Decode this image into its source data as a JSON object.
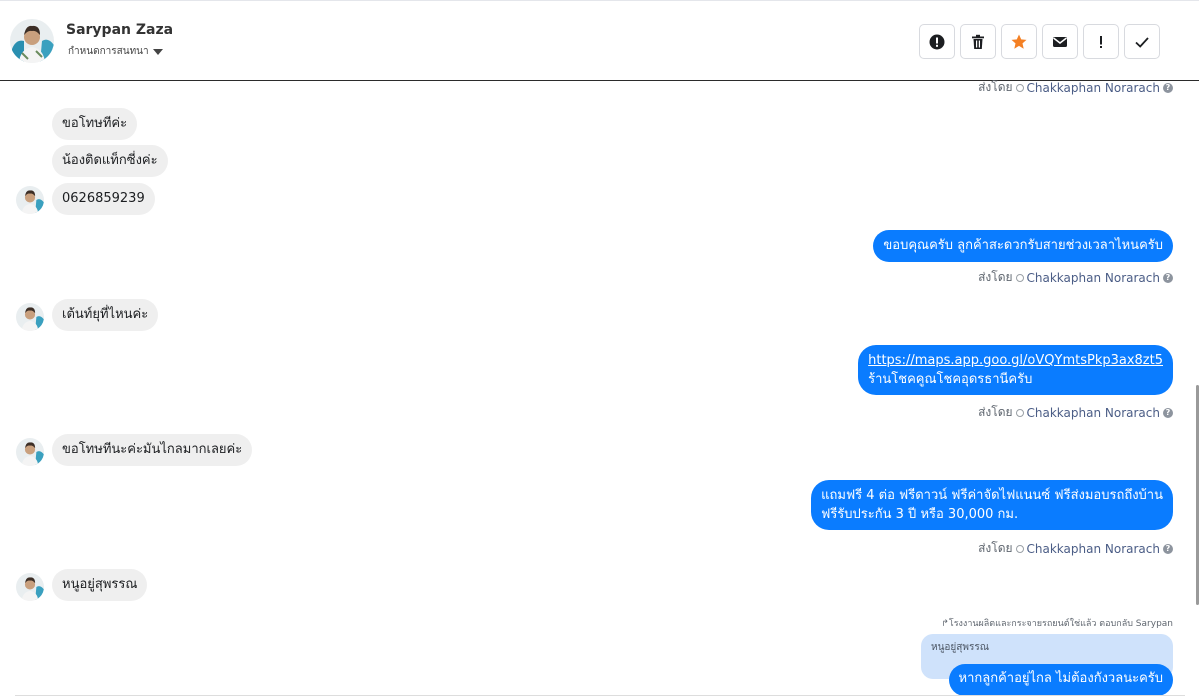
{
  "header": {
    "contact_name": "Sarypan Zaza",
    "subtitle": "กำหนดการสนทนา"
  },
  "toolbar": {
    "buttons": [
      {
        "icon": "alert-circle-icon"
      },
      {
        "icon": "trash-icon"
      },
      {
        "icon": "star-icon",
        "color": "#f48024"
      },
      {
        "icon": "mail-icon"
      },
      {
        "icon": "exclamation-icon"
      },
      {
        "icon": "check-icon"
      }
    ]
  },
  "meta": {
    "sent_by_label": "ส่งโดย",
    "agent_name": "Chakkaphan Norarach",
    "help_glyph": "?"
  },
  "messages": {
    "in_1": "ขอโทษทีค่ะ",
    "in_2": "น้องติดแท็กซี่งค่ะ",
    "in_3": "0626859239",
    "out_1": "ขอบคุณครับ ลูกค้าสะดวกรับสายช่วงเวลาไหนครับ",
    "in_4": "เต้นท์ยุที่ไหนค่ะ",
    "out_2_link": "https://maps.app.goo.gl/oVQYmtsPkp3ax8zt5",
    "out_2_text": "ร้านโชคคูณโชคอุดรธานีครับ",
    "in_5": "ขอโทษทีนะค่ะมันไกลมากเลยค่ะ",
    "out_3_line1": "แถมฟรี 4 ต่อ ฟรีดาวน์ ฟรีค่าจัดไฟแนนซ์ ฟรีส่งมอบรถถึงบ้าน",
    "out_3_line2": "ฟรีรับประกัน 3 ปี หรือ 30,000 กม.",
    "in_6": "หนูอยู่สุพรรณ",
    "reply_note": "โรงงานผลิตและกระจายรถยนต์ใช่แล้ว ตอบกลับ Sarypan",
    "quoted_text": "หนูอยู่สุพรรณ",
    "out_4": "หากลูกค้าอยู่ไกล ไม่ต้องกังวลนะครับ"
  }
}
